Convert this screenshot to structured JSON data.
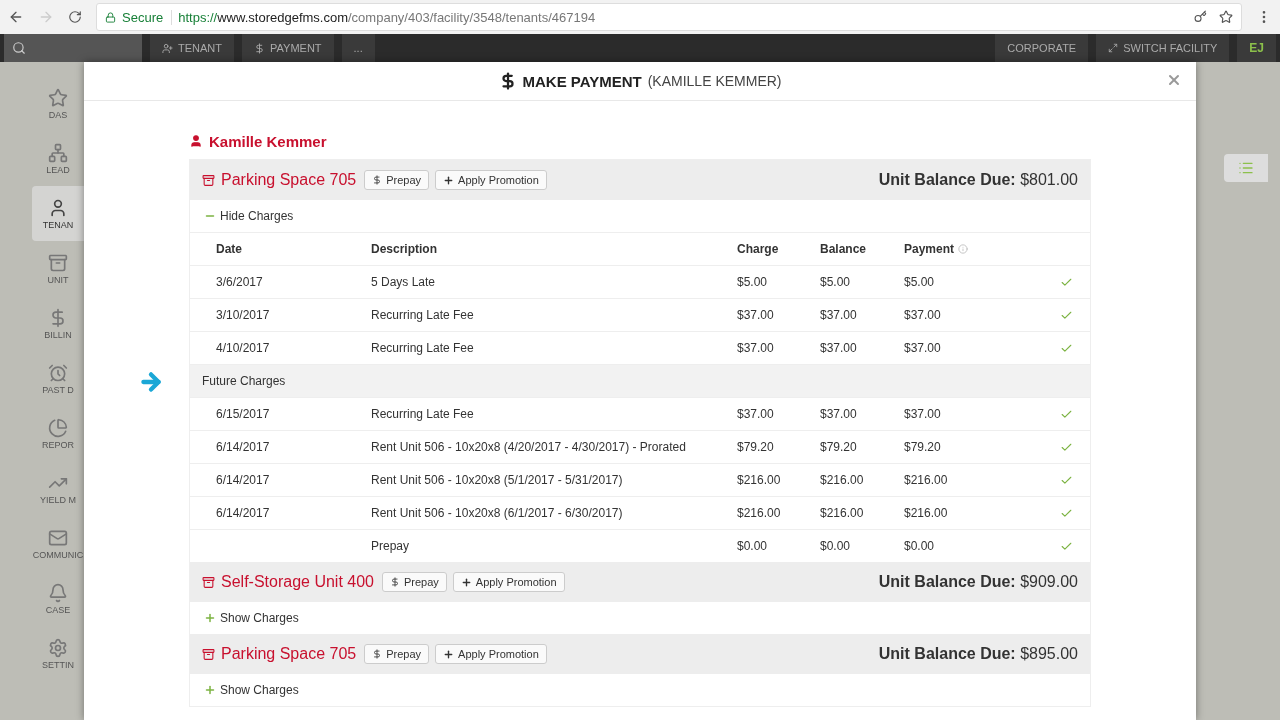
{
  "browser": {
    "secure_label": "Secure",
    "url_scheme": "https://",
    "url_host": "www.storedgefms.com",
    "url_path": "/company/403/facility/3548/tenants/467194"
  },
  "nav": {
    "left": [
      {
        "label": "TENANT"
      },
      {
        "label": "PAYMENT"
      },
      {
        "label": "..."
      }
    ],
    "right": [
      {
        "label": "CORPORATE"
      },
      {
        "label": "SWITCH FACILITY"
      }
    ],
    "user": "EJ"
  },
  "sidebar": {
    "items": [
      {
        "label": "DAS",
        "selected": false
      },
      {
        "label": "LEAD",
        "selected": false
      },
      {
        "label": "TENAN",
        "selected": true
      },
      {
        "label": "UNIT",
        "selected": false
      },
      {
        "label": "BILLIN",
        "selected": false
      },
      {
        "label": "PAST D",
        "selected": false
      },
      {
        "label": "REPOR",
        "selected": false
      },
      {
        "label": "YIELD M",
        "selected": false
      },
      {
        "label": "COMMUNIC",
        "selected": false
      },
      {
        "label": "CASE",
        "selected": false
      },
      {
        "label": "SETTIN",
        "selected": false
      }
    ]
  },
  "modal": {
    "title": "MAKE PAYMENT",
    "subtitle": "(KAMILLE KEMMER)",
    "tenant": "Kamille Kemmer",
    "units": [
      {
        "name": "Parking Space 705",
        "prepay": "Prepay",
        "promotion": "Apply Promotion",
        "balance_label": "Unit Balance Due:",
        "balance": "$801.00",
        "expanded": true,
        "toggle_label": "Hide Charges",
        "columns": [
          "Date",
          "Description",
          "Charge",
          "Balance",
          "Payment"
        ],
        "charges": [
          {
            "date": "3/6/2017",
            "description": "5 Days Late",
            "charge": "$5.00",
            "balance": "$5.00",
            "payment": "$5.00",
            "checked": true
          },
          {
            "date": "3/10/2017",
            "description": "Recurring Late Fee",
            "charge": "$37.00",
            "balance": "$37.00",
            "payment": "$37.00",
            "checked": true
          },
          {
            "date": "4/10/2017",
            "description": "Recurring Late Fee",
            "charge": "$37.00",
            "balance": "$37.00",
            "payment": "$37.00",
            "checked": true
          }
        ],
        "future_label": "Future Charges",
        "future_charges": [
          {
            "date": "6/15/2017",
            "description": "Recurring Late Fee",
            "charge": "$37.00",
            "balance": "$37.00",
            "payment": "$37.00",
            "checked": true
          },
          {
            "date": "6/14/2017",
            "description": "Rent Unit 506 - 10x20x8 (4/20/2017 - 4/30/2017) - Prorated",
            "charge": "$79.20",
            "balance": "$79.20",
            "payment": "$79.20",
            "checked": true
          },
          {
            "date": "6/14/2017",
            "description": "Rent Unit 506 - 10x20x8 (5/1/2017 - 5/31/2017)",
            "charge": "$216.00",
            "balance": "$216.00",
            "payment": "$216.00",
            "checked": true
          },
          {
            "date": "6/14/2017",
            "description": "Rent Unit 506 - 10x20x8 (6/1/2017 - 6/30/2017)",
            "charge": "$216.00",
            "balance": "$216.00",
            "payment": "$216.00",
            "checked": true
          },
          {
            "description": "Prepay",
            "charge": "$0.00",
            "balance": "$0.00",
            "payment": "$0.00",
            "checked": true
          }
        ]
      },
      {
        "name": "Self-Storage Unit 400",
        "prepay": "Prepay",
        "promotion": "Apply Promotion",
        "balance_label": "Unit Balance Due:",
        "balance": "$909.00",
        "expanded": false,
        "toggle_label": "Show Charges"
      },
      {
        "name": "Parking Space 705",
        "prepay": "Prepay",
        "promotion": "Apply Promotion",
        "balance_label": "Unit Balance Due:",
        "balance": "$895.00",
        "expanded": false,
        "toggle_label": "Show Charges"
      }
    ]
  }
}
